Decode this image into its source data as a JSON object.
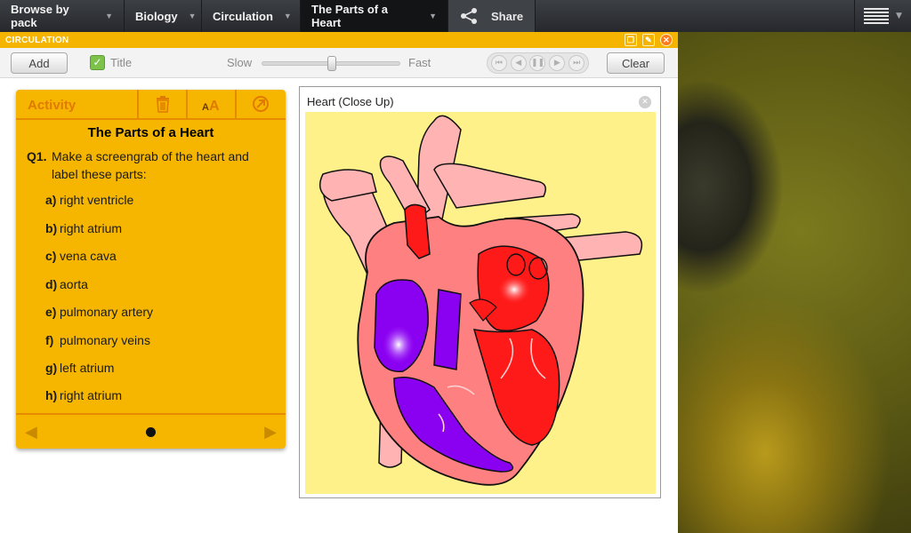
{
  "nav": {
    "items": [
      {
        "label": "Browse by pack"
      },
      {
        "label": "Biology"
      },
      {
        "label": "Circulation"
      },
      {
        "label": "The Parts of a Heart"
      }
    ],
    "share_label": "Share",
    "menu_icon": "hamburger-icon"
  },
  "window": {
    "title": "CIRCULATION"
  },
  "toolbar": {
    "add_label": "Add",
    "title_label": "Title",
    "title_checked": true,
    "slow_label": "Slow",
    "fast_label": "Fast",
    "speed_level": 0.5,
    "clear_label": "Clear"
  },
  "activity": {
    "header_label": "Activity",
    "heading": "The Parts of a Heart",
    "question_number": "Q1.",
    "question_text": "Make a screengrab of the heart and label these parts:",
    "parts": [
      {
        "letter": "a)",
        "text": "right ventricle"
      },
      {
        "letter": "b)",
        "text": "right atrium"
      },
      {
        "letter": "c)",
        "text": "vena cava"
      },
      {
        "letter": "d)",
        "text": "aorta"
      },
      {
        "letter": "e)",
        "text": "pulmonary artery"
      },
      {
        "letter": "f)",
        "text": "pulmonary veins"
      },
      {
        "letter": "g)",
        "text": "left atrium"
      },
      {
        "letter": "h)",
        "text": "right atrium"
      }
    ],
    "page_count": 1,
    "current_page": 1
  },
  "viewer": {
    "title": "Heart (Close Up)"
  },
  "colors": {
    "accent": "#f4b400",
    "card": "#f6b600",
    "heart_bg": "#fff18a",
    "oxygenated": "#ff1a1a",
    "deoxygenated": "#8a00f0",
    "vessel": "#ffb0b0"
  }
}
